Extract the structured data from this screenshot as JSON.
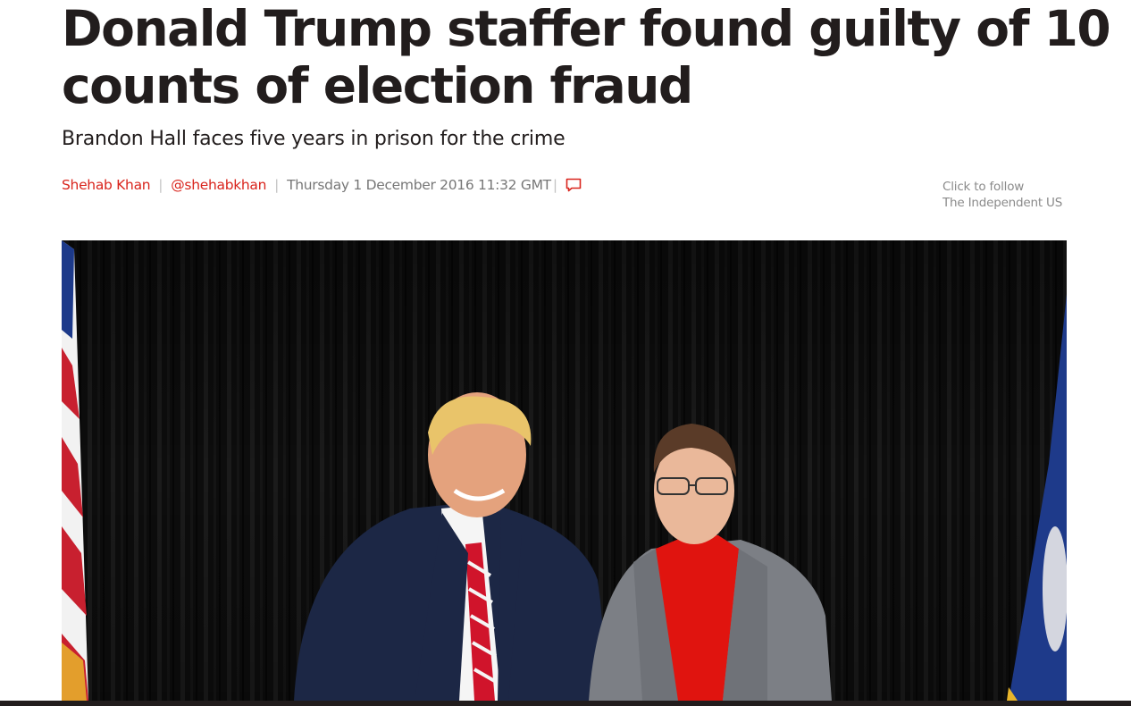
{
  "article": {
    "headline_line1": "Donald Trump staffer found guilty of 10",
    "headline_line2": "counts of election fraud",
    "standfirst": "Brandon Hall faces five years in prison for the crime",
    "author": "Shehab Khan",
    "twitter_handle": "@shehabkhan",
    "date": "Thursday 1 December 2016 11:32 GMT",
    "separator": "|"
  },
  "follow": {
    "line1": "Click to follow",
    "line2": "The Independent US"
  },
  "icons": {
    "comments": "comment-icon"
  },
  "colors": {
    "accent": "#d9251d",
    "headline": "#221d1d",
    "meta": "#777777"
  }
}
